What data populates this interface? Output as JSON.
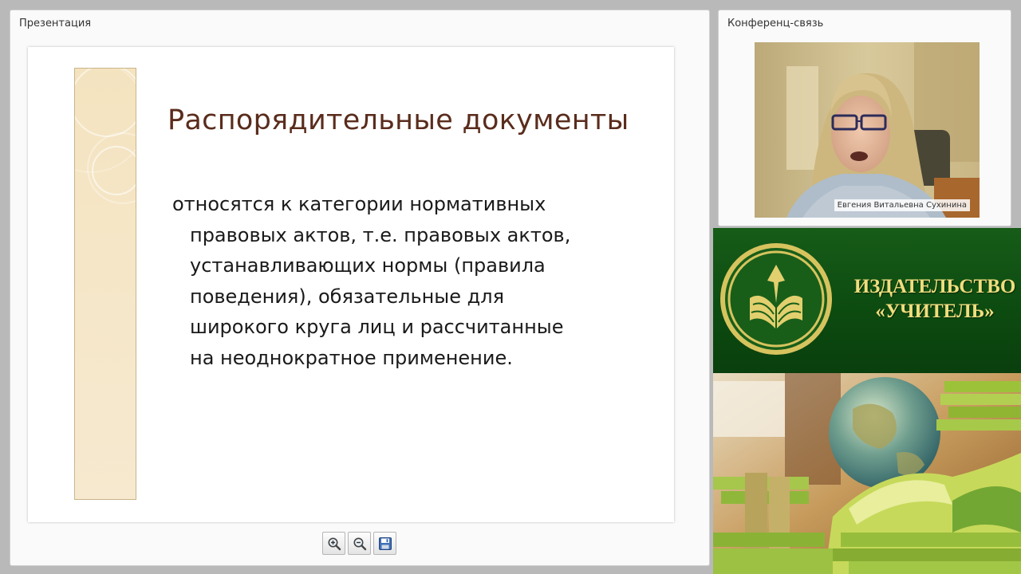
{
  "presentation": {
    "panel_title": "Презентация",
    "slide": {
      "title": "Распорядительные документы",
      "body_lines": [
        "относятся к категории нормативных",
        "правовых актов, т.е. правовых актов,",
        "устанавливающих нормы (правила",
        "поведения), обязательные для",
        "широкого круга лиц  и рассчитанные",
        "на неоднократное применение."
      ]
    },
    "toolbar": {
      "zoom_in_icon": "zoom-in-icon",
      "zoom_out_icon": "zoom-out-icon",
      "save_icon": "floppy-disk-icon"
    }
  },
  "conference": {
    "panel_title": "Конференц-связь",
    "speaker_name": "Евгения Витальевна Сухинина"
  },
  "banner": {
    "line1": "ИЗДАТЕЛЬСТВО",
    "line2": "«УЧИТЕЛЬ»",
    "logo_icon": "book-emblem-icon",
    "colors": {
      "green": "#175c18",
      "gold": "#f0dd7e"
    }
  }
}
